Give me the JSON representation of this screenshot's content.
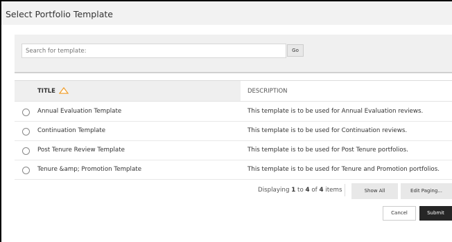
{
  "dialog": {
    "title": "Select Portfolio Template"
  },
  "search": {
    "placeholder": "Search for template:",
    "value": "",
    "go_label": "Go"
  },
  "table": {
    "columns": {
      "title": "TITLE",
      "description": "DESCRIPTION"
    },
    "sort_column": "TITLE",
    "sort_direction": "ascending",
    "rows": [
      {
        "title": "Annual Evaluation Template",
        "description": "This template is to be used for Annual Evaluation reviews.",
        "selected": false
      },
      {
        "title": "Continuation Template",
        "description": "This template is to be used for Continuation reviews.",
        "selected": false
      },
      {
        "title": "Post Tenure Review Template",
        "description": "This template is to be used for Post Tenure portfolios.",
        "selected": false
      },
      {
        "title": "Tenure &amp; Promotion Template",
        "description": "This template is to be used for Tenure and Promotion portfolios.",
        "selected": false
      }
    ]
  },
  "paging": {
    "prefix": "Displaying",
    "from": "1",
    "to_word": "to",
    "to": "4",
    "of_word": "of",
    "total": "4",
    "suffix": "items",
    "show_all_label": "Show All",
    "edit_paging_label": "Edit Paging..."
  },
  "actions": {
    "cancel_label": "Cancel",
    "submit_label": "Submit"
  },
  "colors": {
    "header_background": "#f2f2f2",
    "sort_indicator": "#f0a030",
    "submit_background": "#262626"
  },
  "icons": {
    "sort": "sort-ascending-triangle-icon"
  }
}
